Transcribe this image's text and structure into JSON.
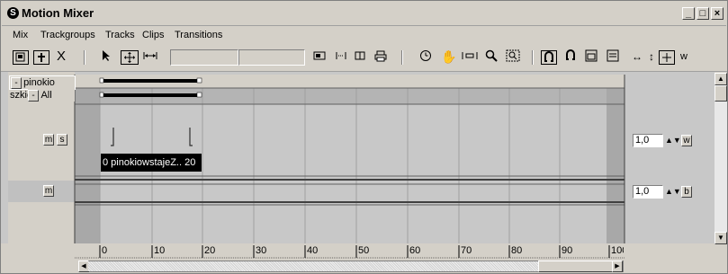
{
  "window": {
    "title": "Motion Mixer",
    "icon": "mixer-app-icon",
    "controls": [
      "_",
      "□",
      "×"
    ]
  },
  "menu": [
    "Mix",
    "Trackgroups",
    "Tracks",
    "Clips",
    "Transitions"
  ],
  "toolbar": {
    "left_icons": [
      "mixer-view-icon",
      "add-icon",
      "close-x-icon"
    ],
    "close_label": "X",
    "cursor_icons": [
      "select-arrow-icon",
      "move-icon",
      "scale-icon"
    ],
    "field1_value": "",
    "field2_value": "",
    "right_icons": [
      "filter-icon",
      "range-icon",
      "range2-icon",
      "print-icon",
      "clock-icon",
      "pan-hand-icon",
      "zoom-extents-icon",
      "magnify-icon",
      "zoom-region-icon",
      "snap-icon",
      "snap2-icon",
      "frame-icon",
      "settings-icon",
      "arrow-h-icon",
      "arrow-v-icon",
      "zoom-icon"
    ],
    "w_label": "w"
  },
  "tracks": {
    "object_name": "pinokio szkiel",
    "group_name": "All",
    "m_label": "m",
    "s_label": "s",
    "clip_label": "0  pinokiowstajeZ.. 20",
    "m2_label": "m",
    "spinner1_value": "1,0",
    "spinner2_value": "1,0",
    "w_btn_label": "w",
    "b_btn_label": "b"
  },
  "ruler": {
    "ticks": [
      "0",
      "10",
      "20",
      "30",
      "40",
      "50",
      "60",
      "70",
      "80",
      "90",
      "100"
    ]
  },
  "scroll": {
    "horizontal_position": 0.95,
    "vertical_position": 0.05
  }
}
